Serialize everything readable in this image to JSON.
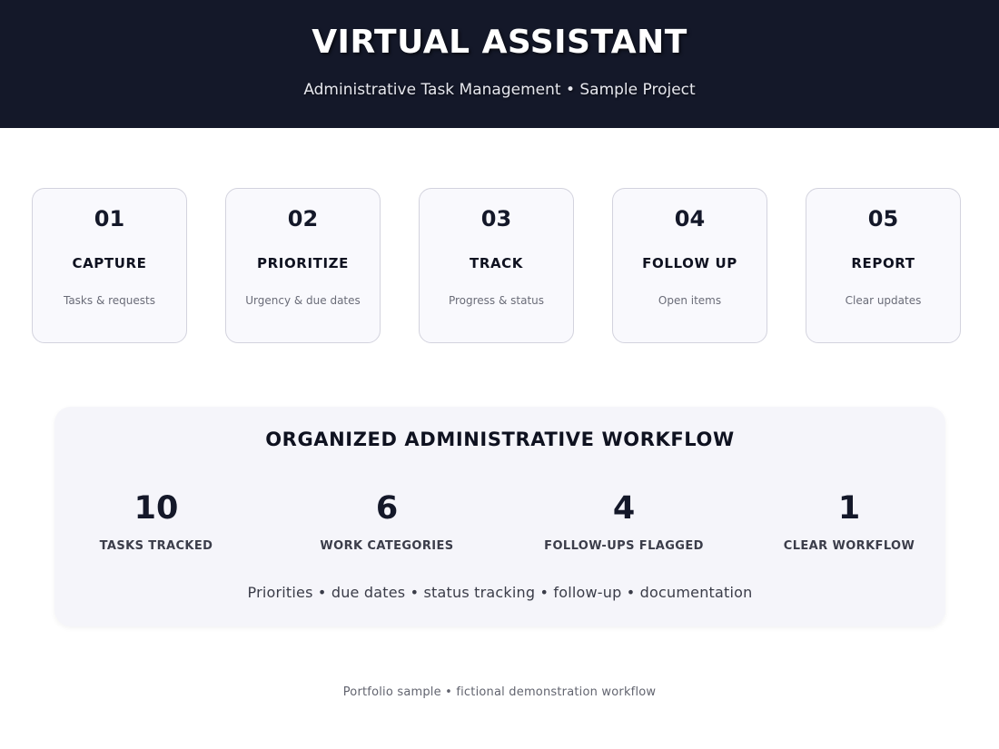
{
  "header": {
    "title": "VIRTUAL ASSISTANT",
    "subtitle": "Administrative Task Management • Sample Project",
    "background": "#141829"
  },
  "steps": [
    {
      "num": "01",
      "title": "CAPTURE",
      "desc": "Tasks & requests"
    },
    {
      "num": "02",
      "title": "PRIORITIZE",
      "desc": "Urgency & due dates"
    },
    {
      "num": "03",
      "title": "TRACK",
      "desc": "Progress & status"
    },
    {
      "num": "04",
      "title": "FOLLOW UP",
      "desc": "Open items"
    },
    {
      "num": "05",
      "title": "REPORT",
      "desc": "Clear updates"
    }
  ],
  "summary": {
    "title": "ORGANIZED ADMINISTRATIVE WORKFLOW",
    "stats": [
      {
        "value": "10",
        "label": "TASKS TRACKED"
      },
      {
        "value": "6",
        "label": "WORK CATEGORIES"
      },
      {
        "value": "4",
        "label": "FOLLOW-UPS FLAGGED"
      },
      {
        "value": "1",
        "label": "CLEAR WORKFLOW"
      }
    ],
    "tags": "Priorities • due dates • status tracking • follow-up • documentation"
  },
  "footer": {
    "text": "Portfolio sample • fictional demonstration workflow"
  }
}
